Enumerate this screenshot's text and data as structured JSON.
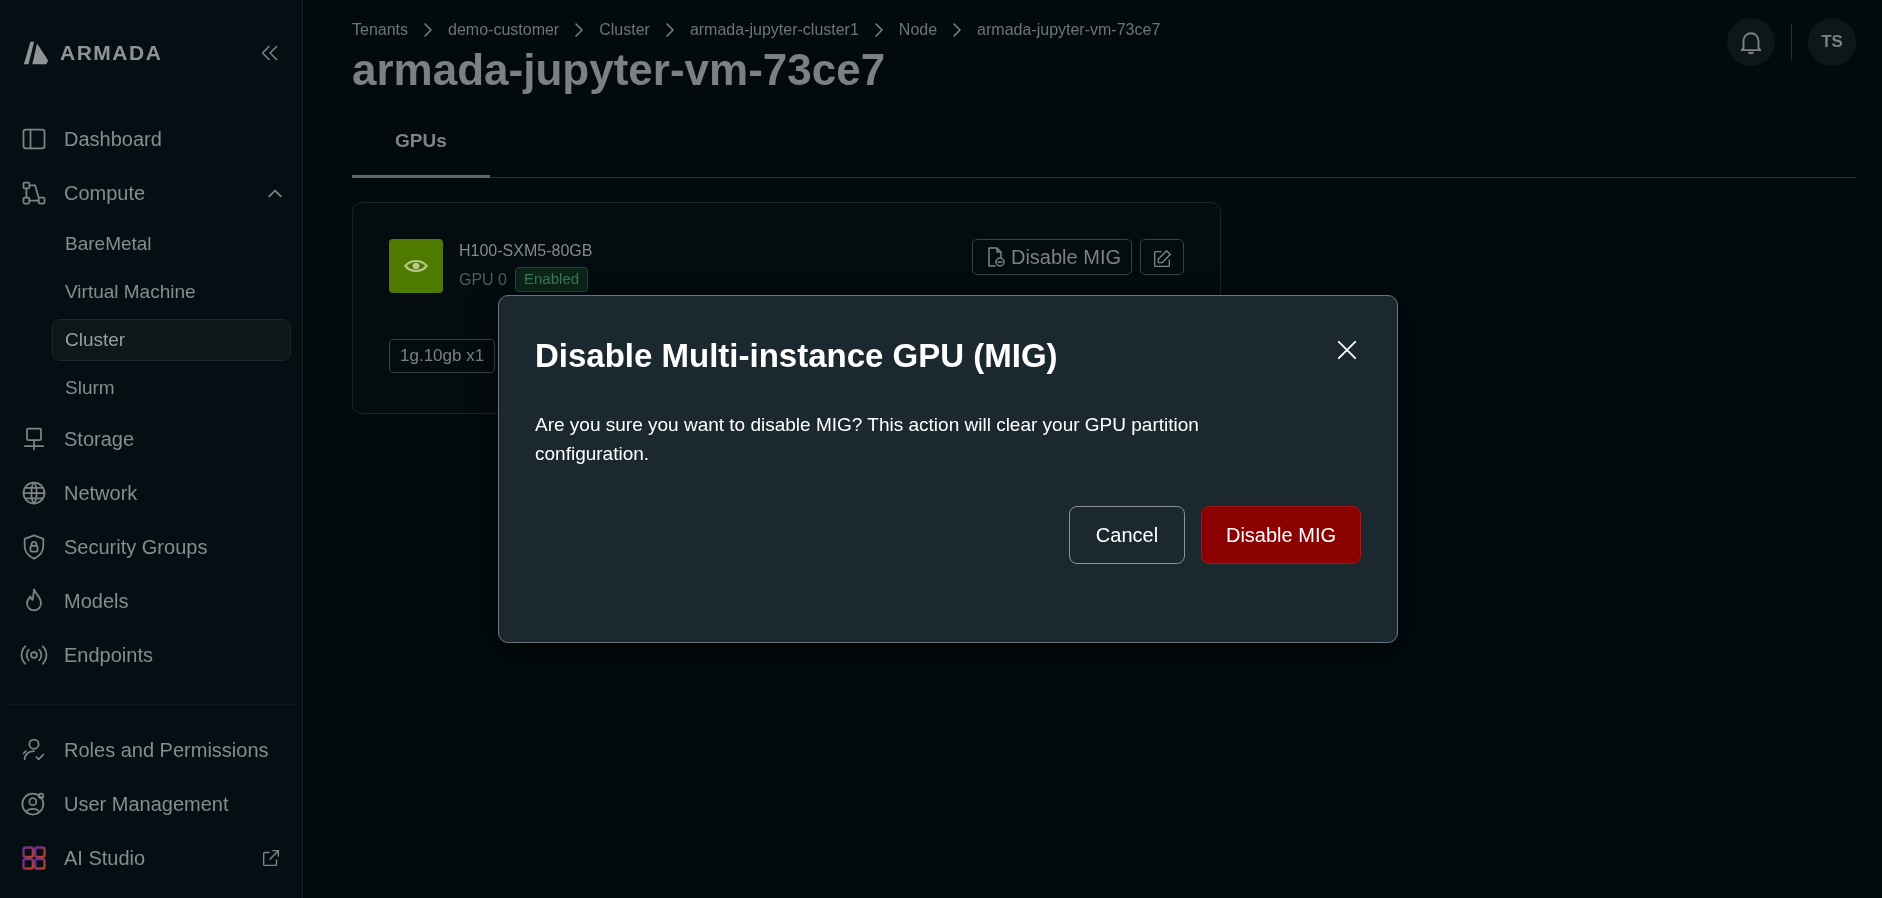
{
  "sidebar": {
    "logo_text": "ARMADA",
    "items": [
      {
        "label": "Dashboard",
        "selected": false
      },
      {
        "label": "Compute",
        "selected": false,
        "expanded": true,
        "children": [
          {
            "label": "BareMetal",
            "selected": false
          },
          {
            "label": "Virtual Machine",
            "selected": false
          },
          {
            "label": "Cluster",
            "selected": true
          },
          {
            "label": "Slurm",
            "selected": false
          }
        ]
      },
      {
        "label": "Storage",
        "selected": false
      },
      {
        "label": "Network",
        "selected": false
      },
      {
        "label": "Security Groups",
        "selected": false
      },
      {
        "label": "Models",
        "selected": false
      },
      {
        "label": "Endpoints",
        "selected": false
      }
    ],
    "footer_items": [
      {
        "label": "Roles and Permissions",
        "external": false
      },
      {
        "label": "User Management",
        "external": false
      },
      {
        "label": "AI Studio",
        "external": true
      }
    ]
  },
  "header": {
    "avatar_initials": "TS"
  },
  "breadcrumb": [
    "Tenants",
    "demo-customer",
    "Cluster",
    "armada-jupyter-cluster1",
    "Node",
    "armada-jupyter-vm-73ce7"
  ],
  "page_title": "armada-jupyter-vm-73ce7",
  "tabs": [
    {
      "label": "GPUs",
      "selected": true
    }
  ],
  "gpu_cards": [
    {
      "model": "H100-SXM5-80GB",
      "index_label": "GPU 0",
      "status": "Enabled",
      "action": "Disable MIG",
      "partitions": [
        "1g.10gb x1"
      ]
    }
  ],
  "dialog": {
    "title": "Disable Multi-instance GPU (MIG)",
    "message": "Are you sure you want to disable MIG? This action will clear your GPU partition configuration.",
    "buttons": [
      {
        "label": "Cancel",
        "kind": "secondary"
      },
      {
        "label": "Disable MIG",
        "kind": "danger"
      }
    ]
  }
}
